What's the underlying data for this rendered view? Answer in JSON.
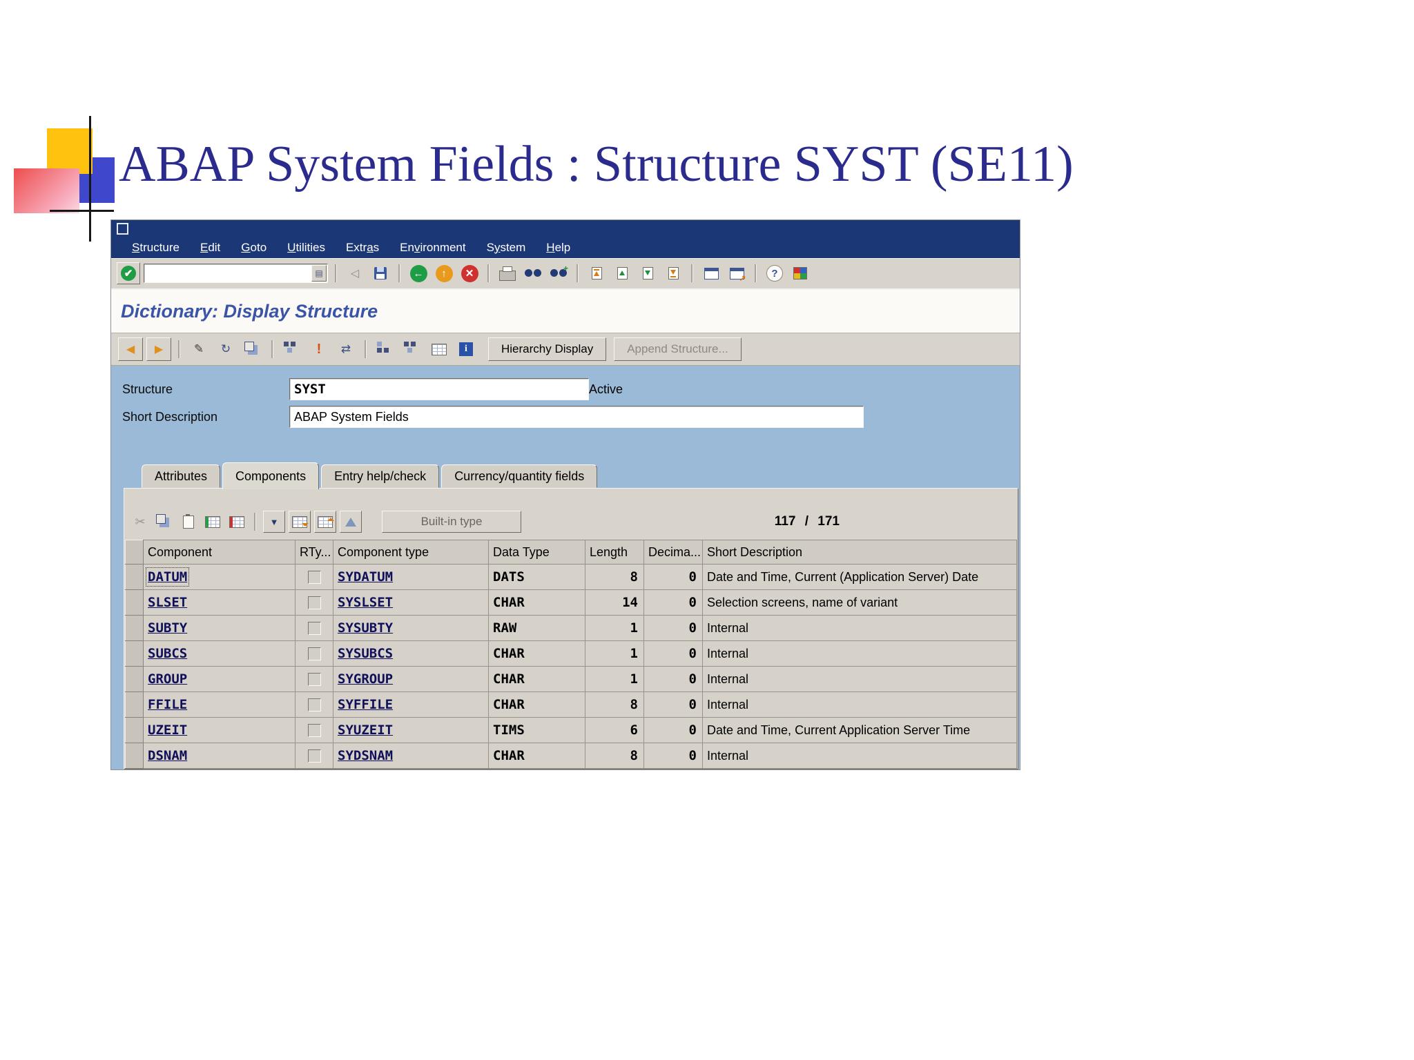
{
  "slide": {
    "title": "ABAP System Fields : Structure SYST (SE11)"
  },
  "menu": {
    "items": [
      {
        "label": "Structure",
        "accel": 0
      },
      {
        "label": "Edit",
        "accel": 0
      },
      {
        "label": "Goto",
        "accel": 0
      },
      {
        "label": "Utilities",
        "accel": 0
      },
      {
        "label": "Extras",
        "accel": 4
      },
      {
        "label": "Environment",
        "accel": 2
      },
      {
        "label": "System",
        "accel": 1
      },
      {
        "label": "Help",
        "accel": 0
      }
    ]
  },
  "toolbar": {
    "command_value": ""
  },
  "screen": {
    "title": "Dictionary: Display Structure"
  },
  "app_toolbar": {
    "hierarchy_display": "Hierarchy Display",
    "append_structure": "Append Structure..."
  },
  "form": {
    "structure_label": "Structure",
    "structure_value": "SYST",
    "status": "Active",
    "short_desc_label": "Short Description",
    "short_desc_value": "ABAP System Fields"
  },
  "tabs": {
    "items": [
      "Attributes",
      "Components",
      "Entry help/check",
      "Currency/quantity fields"
    ],
    "active_index": 1
  },
  "grid_toolbar": {
    "built_in_type": "Built-in type",
    "count_current": "117",
    "count_divider": "/",
    "count_total": "171"
  },
  "grid": {
    "columns": [
      "Component",
      "RTy...",
      "Component type",
      "Data Type",
      "Length",
      "Decima...",
      "Short Description"
    ],
    "rows": [
      {
        "component": "DATUM",
        "component_type": "SYDATUM",
        "data_type": "DATS",
        "length": "8",
        "decimals": "0",
        "short_description": "Date and Time, Current (Application Server) Date"
      },
      {
        "component": "SLSET",
        "component_type": "SYSLSET",
        "data_type": "CHAR",
        "length": "14",
        "decimals": "0",
        "short_description": "Selection screens, name of variant"
      },
      {
        "component": "SUBTY",
        "component_type": "SYSUBTY",
        "data_type": "RAW",
        "length": "1",
        "decimals": "0",
        "short_description": "Internal"
      },
      {
        "component": "SUBCS",
        "component_type": "SYSUBCS",
        "data_type": "CHAR",
        "length": "1",
        "decimals": "0",
        "short_description": "Internal"
      },
      {
        "component": "GROUP",
        "component_type": "SYGROUP",
        "data_type": "CHAR",
        "length": "1",
        "decimals": "0",
        "short_description": "Internal"
      },
      {
        "component": "FFILE",
        "component_type": "SYFFILE",
        "data_type": "CHAR",
        "length": "8",
        "decimals": "0",
        "short_description": "Internal"
      },
      {
        "component": "UZEIT",
        "component_type": "SYUZEIT",
        "data_type": "TIMS",
        "length": "6",
        "decimals": "0",
        "short_description": "Date and Time, Current Application Server Time"
      },
      {
        "component": "DSNAM",
        "component_type": "SYDSNAM",
        "data_type": "CHAR",
        "length": "8",
        "decimals": "0",
        "short_description": "Internal"
      }
    ]
  }
}
